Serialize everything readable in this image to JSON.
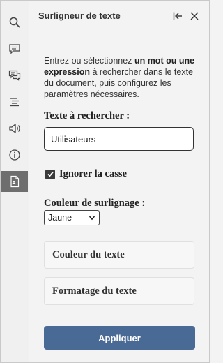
{
  "panel": {
    "title": "Surligneur de texte",
    "description": {
      "part1": "Entrez ou sélectionnez ",
      "bold": "un mot ou une expression",
      "part2": " à rechercher dans le texte du document, puis configurez les paramètres nécessaires."
    },
    "search": {
      "label": "Texte à rechercher :",
      "value": "Utilisateurs"
    },
    "ignore_case": {
      "label": "Ignorer la casse",
      "checked": true
    },
    "highlight_color": {
      "label": "Couleur de surlignage :",
      "selected": "Jaune"
    },
    "sections": {
      "text_color": "Couleur du texte",
      "text_formatting": "Formatage du texte"
    },
    "apply_label": "Appliquer"
  },
  "rail": {
    "icons": [
      "search-icon",
      "comment-icon",
      "chat-icon",
      "align-icon",
      "speaker-icon",
      "info-icon",
      "document-icon"
    ],
    "active": "document-icon"
  },
  "colors": {
    "accent": "#4a6a96",
    "active_rail": "#6e6e6e"
  }
}
